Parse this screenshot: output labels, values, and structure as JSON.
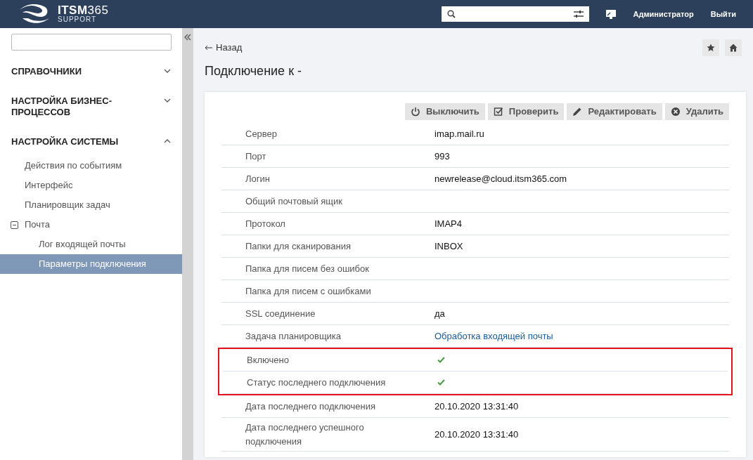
{
  "header": {
    "logo_title": "**ITSM**365",
    "logo_subtitle": "SUPPORT",
    "user": "Администратор",
    "logout": "Выйти"
  },
  "sidebar": {
    "sections": [
      {
        "label": "СПРАВОЧНИКИ",
        "expanded": false
      },
      {
        "label": "НАСТРОЙКА БИЗНЕС-ПРОЦЕССОВ",
        "expanded": false
      },
      {
        "label": "НАСТРОЙКА СИСТЕМЫ",
        "expanded": true,
        "children": [
          {
            "label": "Действия по событиям",
            "selected": false
          },
          {
            "label": "Интерфейс",
            "selected": false
          },
          {
            "label": "Планировщик задач",
            "selected": false
          },
          {
            "label": "Почта",
            "selected": false,
            "expanded": true,
            "children": [
              {
                "label": "Лог входящей почты",
                "selected": false
              },
              {
                "label": "Параметры подключения",
                "selected": true
              }
            ]
          }
        ]
      }
    ]
  },
  "back": "Назад",
  "title": "Подключение к -",
  "actions": [
    {
      "kind": "power",
      "label": "Выключить"
    },
    {
      "kind": "check",
      "label": "Проверить"
    },
    {
      "kind": "edit",
      "label": "Редактировать"
    },
    {
      "kind": "delete",
      "label": "Удалить"
    }
  ],
  "fields": [
    {
      "label": "Сервер",
      "kind": "text",
      "value": "imap.mail.ru",
      "highlighted": false
    },
    {
      "label": "Порт",
      "kind": "text",
      "value": "993",
      "highlighted": false
    },
    {
      "label": "Логин",
      "kind": "text",
      "value": "newrelease@cloud.itsm365.com",
      "highlighted": false
    },
    {
      "label": "Общий почтовый ящик",
      "kind": "text",
      "highlighted": false
    },
    {
      "label": "Протокол",
      "kind": "text",
      "value": "IMAP4",
      "highlighted": false
    },
    {
      "label": "Папки для сканирования",
      "kind": "text",
      "value": "INBOX",
      "highlighted": false
    },
    {
      "label": "Папка для писем без ошибок",
      "kind": "text",
      "highlighted": false
    },
    {
      "label": "Папка для писем с ошибками",
      "kind": "text",
      "highlighted": false
    },
    {
      "label": "SSL соединение",
      "kind": "text",
      "value": "да",
      "highlighted": false
    },
    {
      "label": "Задача планировщика",
      "kind": "link",
      "value": "Обработка входящей почты",
      "highlighted": false
    },
    {
      "label": "Включено",
      "kind": "flag",
      "checked": true,
      "highlighted": true
    },
    {
      "label": "Статус последнего подключения",
      "kind": "flag",
      "checked": true,
      "highlighted": true
    },
    {
      "label": "Дата последнего подключения",
      "kind": "text",
      "value": "20.10.2020 13:31:40",
      "highlighted": false
    },
    {
      "label": "Дата последнего успешного подключения",
      "kind": "text",
      "value": "20.10.2020 13:31:40",
      "highlighted": false
    }
  ]
}
